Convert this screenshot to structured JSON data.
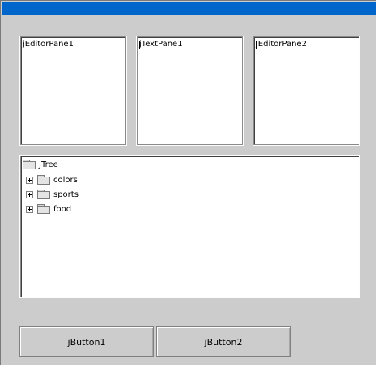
{
  "window": {
    "title_bar_color": "#0066cc",
    "background_color": "#cccccc"
  },
  "editor_panes": [
    {
      "text": "jEditorPane1"
    },
    {
      "text": "jTextPane1"
    },
    {
      "text": "jEditorPane2"
    }
  ],
  "tree": {
    "root": {
      "label": "JTree",
      "icon": "folder-icon"
    },
    "children": [
      {
        "label": "colors",
        "icon": "folder-icon",
        "expander": "plus-expander-icon"
      },
      {
        "label": "sports",
        "icon": "folder-icon",
        "expander": "plus-expander-icon"
      },
      {
        "label": "food",
        "icon": "folder-icon",
        "expander": "plus-expander-icon"
      }
    ]
  },
  "buttons": [
    {
      "label": "jButton1"
    },
    {
      "label": "jButton2"
    }
  ]
}
